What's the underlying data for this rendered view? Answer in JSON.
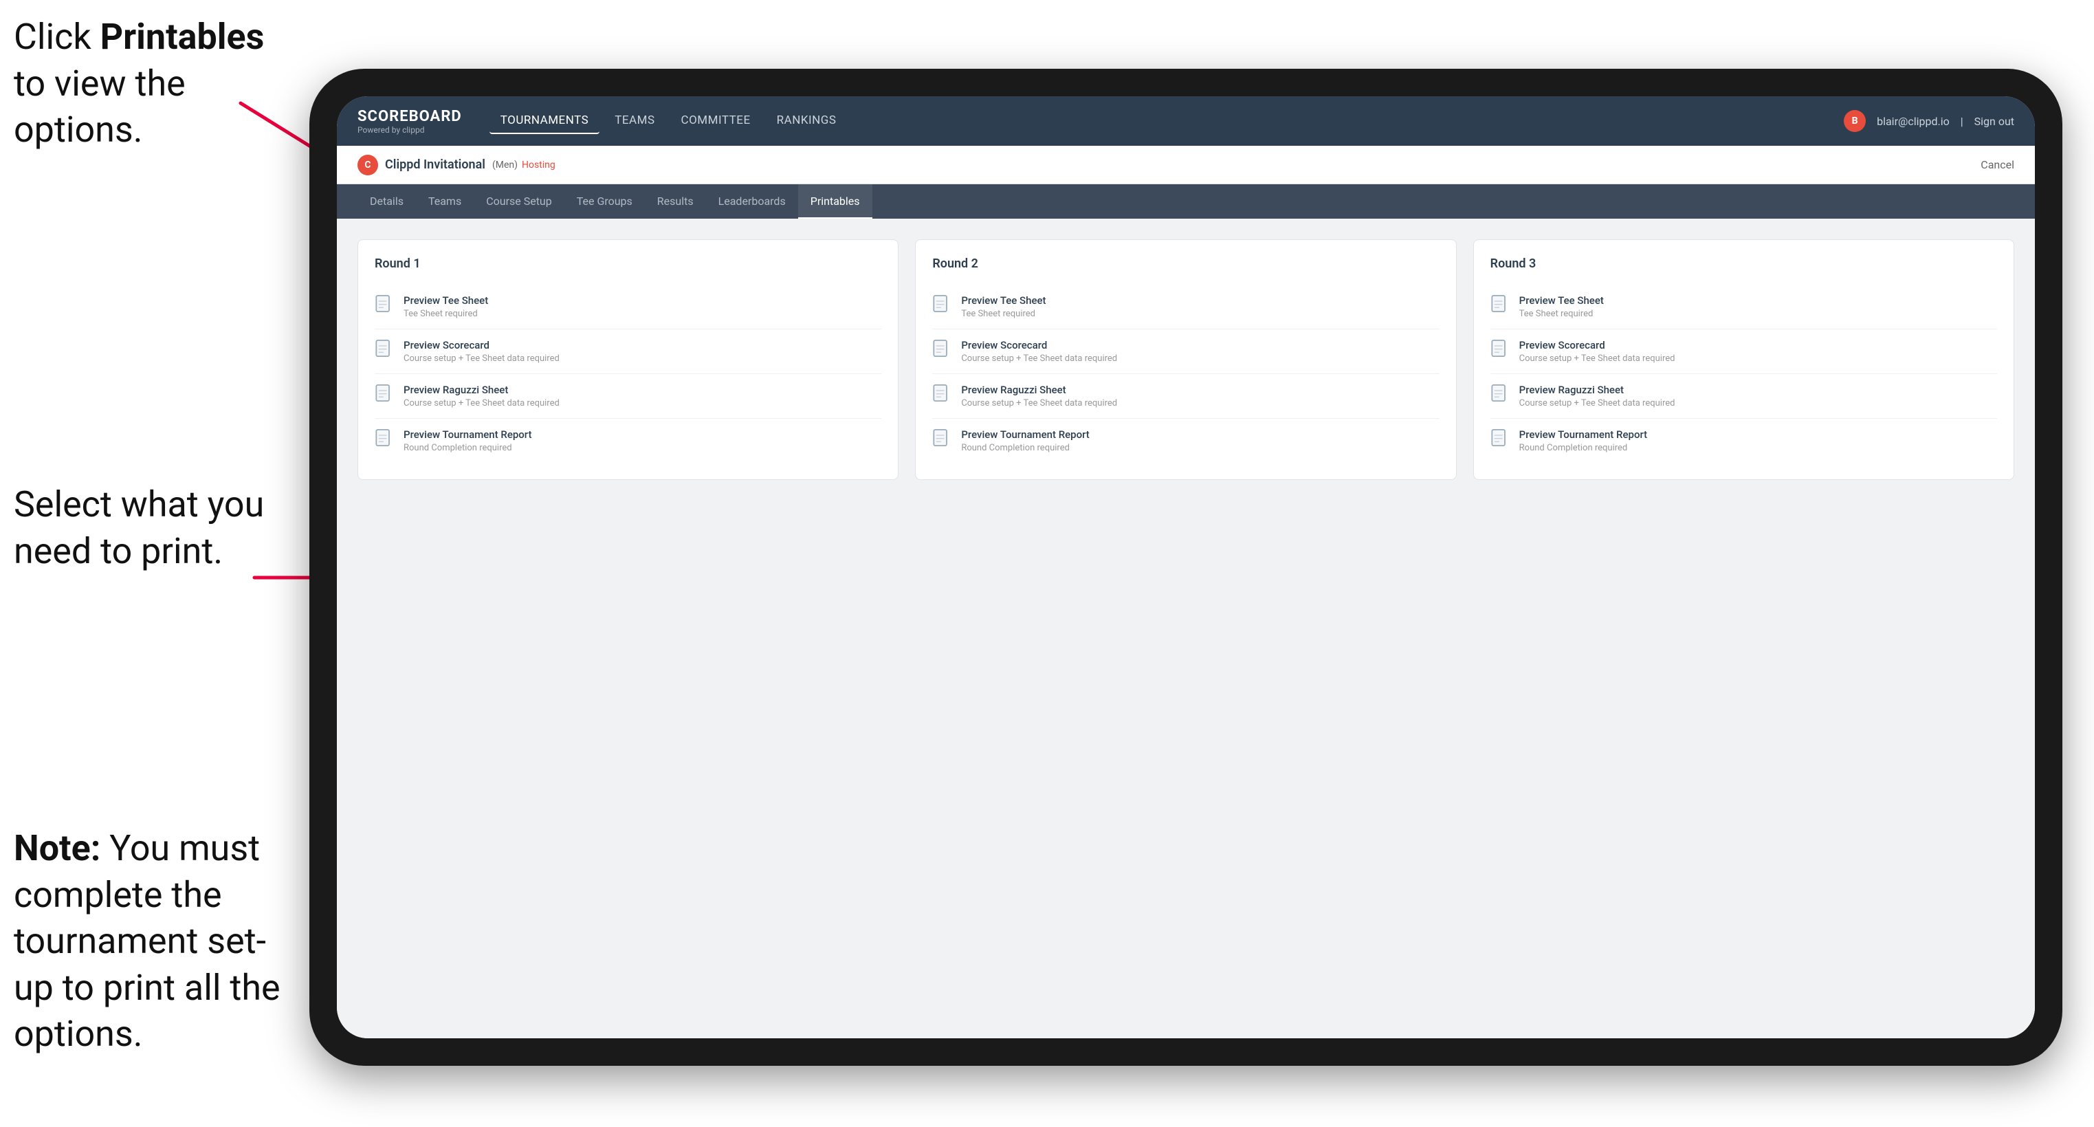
{
  "instructions": {
    "top": "Click ",
    "top_bold": "Printables",
    "top_rest": " to view the options.",
    "middle": "Select what you need to print.",
    "bottom_bold": "Note:",
    "bottom_rest": " You must complete the tournament set-up to print all the options."
  },
  "nav": {
    "logo": "SCOREBOARD",
    "logo_sub": "Powered by clippd",
    "links": [
      "TOURNAMENTS",
      "TEAMS",
      "COMMITTEE",
      "RANKINGS"
    ],
    "user_email": "blair@clippd.io",
    "sign_out": "Sign out"
  },
  "tournament": {
    "name": "Clippd Invitational",
    "badge": "(Men)",
    "hosting": "Hosting",
    "cancel": "Cancel"
  },
  "sub_nav": {
    "links": [
      "Details",
      "Teams",
      "Course Setup",
      "Tee Groups",
      "Results",
      "Leaderboards",
      "Printables"
    ],
    "active": "Printables"
  },
  "rounds": [
    {
      "title": "Round 1",
      "items": [
        {
          "title": "Preview Tee Sheet",
          "subtitle": "Tee Sheet required"
        },
        {
          "title": "Preview Scorecard",
          "subtitle": "Course setup + Tee Sheet data required"
        },
        {
          "title": "Preview Raguzzi Sheet",
          "subtitle": "Course setup + Tee Sheet data required"
        },
        {
          "title": "Preview Tournament Report",
          "subtitle": "Round Completion required"
        }
      ]
    },
    {
      "title": "Round 2",
      "items": [
        {
          "title": "Preview Tee Sheet",
          "subtitle": "Tee Sheet required"
        },
        {
          "title": "Preview Scorecard",
          "subtitle": "Course setup + Tee Sheet data required"
        },
        {
          "title": "Preview Raguzzi Sheet",
          "subtitle": "Course setup + Tee Sheet data required"
        },
        {
          "title": "Preview Tournament Report",
          "subtitle": "Round Completion required"
        }
      ]
    },
    {
      "title": "Round 3",
      "items": [
        {
          "title": "Preview Tee Sheet",
          "subtitle": "Tee Sheet required"
        },
        {
          "title": "Preview Scorecard",
          "subtitle": "Course setup + Tee Sheet data required"
        },
        {
          "title": "Preview Raguzzi Sheet",
          "subtitle": "Course setup + Tee Sheet data required"
        },
        {
          "title": "Preview Tournament Report",
          "subtitle": "Round Completion required"
        }
      ]
    }
  ]
}
